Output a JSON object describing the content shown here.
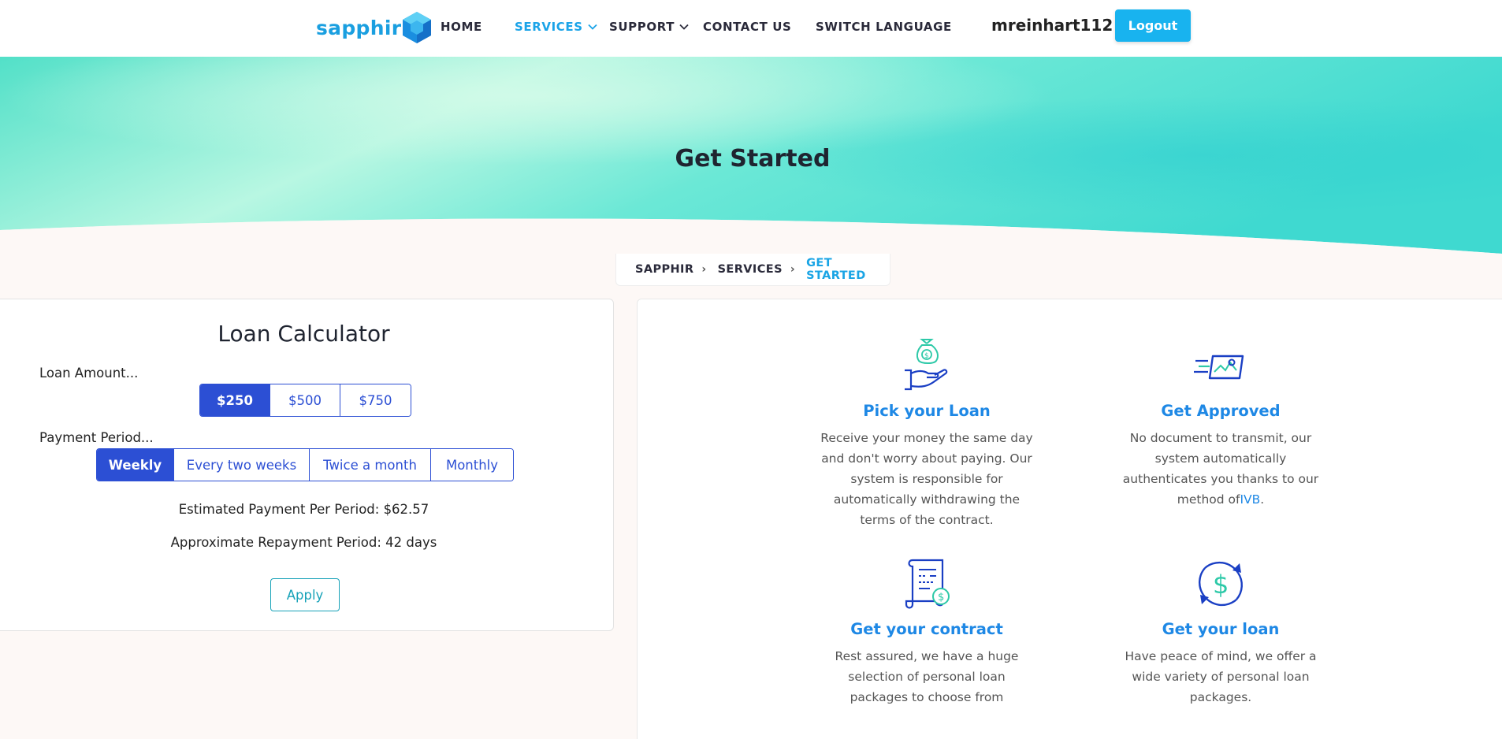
{
  "nav": {
    "brand": "sapphir",
    "items": [
      {
        "label": "HOME"
      },
      {
        "label": "SERVICES"
      },
      {
        "label": "SUPPORT"
      },
      {
        "label": "CONTACT US"
      },
      {
        "label": "SWITCH LANGUAGE"
      }
    ],
    "username": "mreinhart112",
    "logout_label": "Logout"
  },
  "hero": {
    "title": "Get Started"
  },
  "breadcrumb": [
    "SAPPHIR",
    "SERVICES",
    "GET STARTED"
  ],
  "calculator": {
    "title": "Loan Calculator",
    "amount_label": "Loan Amount...",
    "amounts": [
      "$250",
      "$500",
      "$750"
    ],
    "selected_amount": "$250",
    "period_label": "Payment Period...",
    "periods": [
      "Weekly",
      "Every two weeks",
      "Twice a month",
      "Monthly"
    ],
    "selected_period": "Weekly",
    "estimated_payment": "Estimated Payment Per Period: $62.57",
    "repayment_period": "Approximate Repayment Period: 42 days",
    "apply_label": "Apply"
  },
  "steps": [
    {
      "icon": "money-bag-hand-icon",
      "title": "Pick your Loan",
      "desc": "Receive your money the same day and don't worry about paying. Our system is responsible for automatically withdrawing the terms of the contract."
    },
    {
      "icon": "fast-id-card-icon",
      "title": "Get Approved",
      "desc_prefix": "No document to transmit, our system automatically authenticates you thanks to our method of",
      "desc_link": "IVB",
      "desc_suffix": "."
    },
    {
      "icon": "contract-scroll-icon",
      "title": "Get your contract",
      "desc": "Rest assured, we have a huge selection of personal loan packages to choose from"
    },
    {
      "icon": "dollar-cycle-icon",
      "title": "Get your loan",
      "desc": "Have peace of mind, we offer a wide variety of personal loan packages."
    }
  ],
  "colors": {
    "accent": "#1aa3e8",
    "primary_blue": "#2c4fd4",
    "step_title": "#1e88e5",
    "apply_teal": "#17a2b8"
  }
}
